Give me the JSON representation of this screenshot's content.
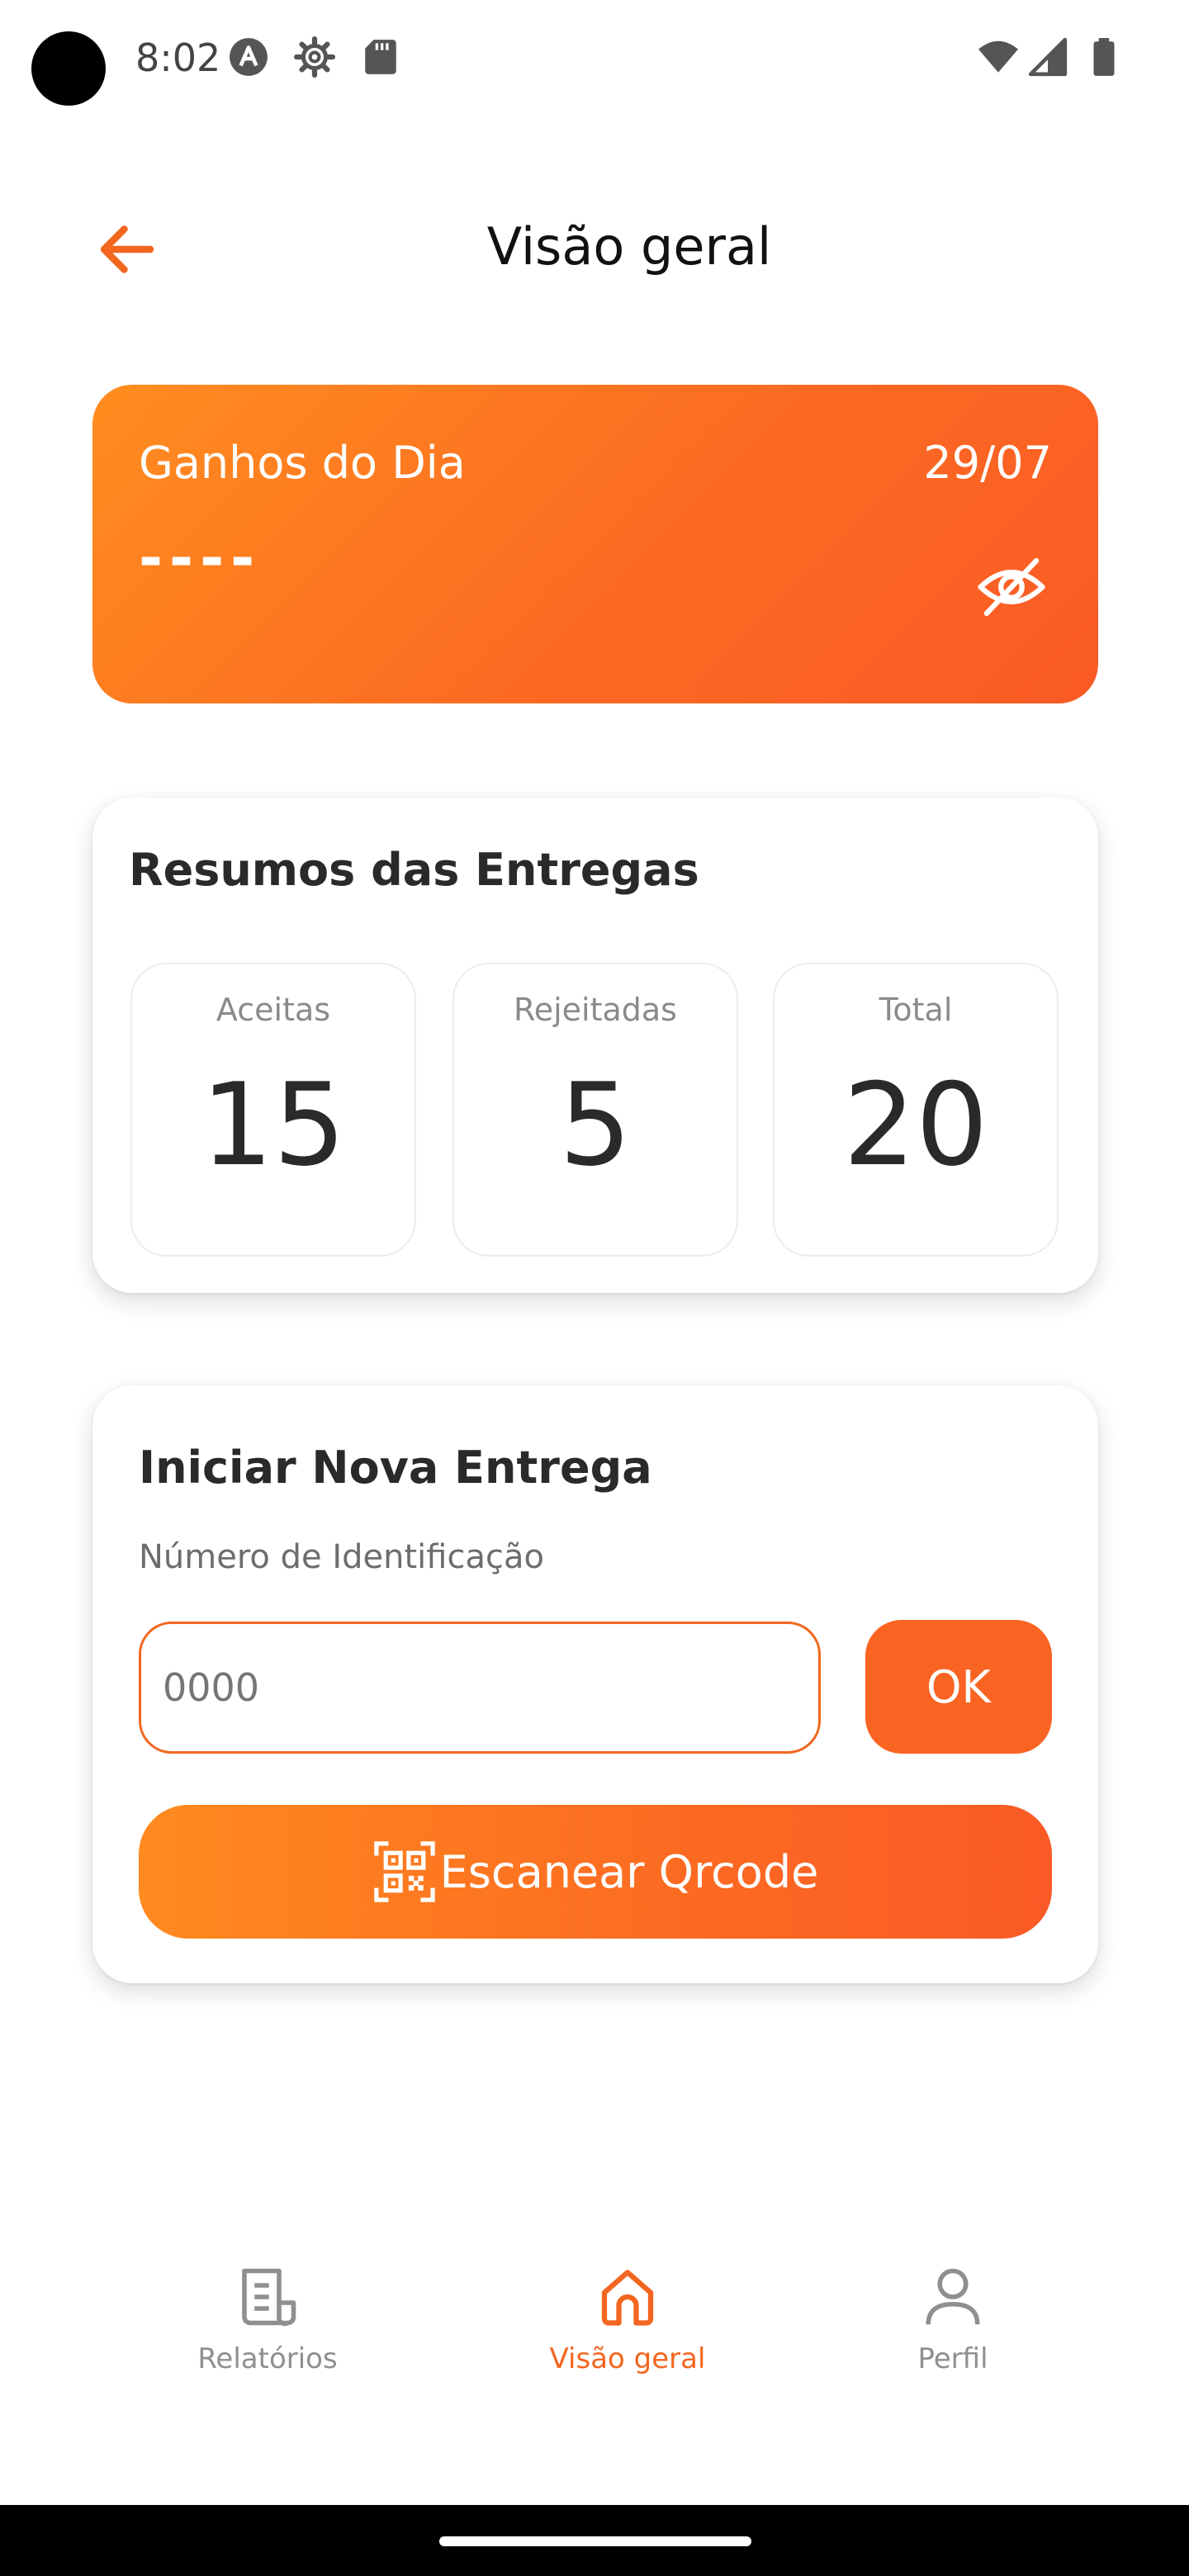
{
  "status_bar": {
    "time": "8:02",
    "icons": [
      "assistant-icon",
      "settings-gear-icon",
      "sd-card-icon",
      "wifi-icon",
      "signal-icon",
      "battery-icon"
    ]
  },
  "header": {
    "title": "Visão geral",
    "back_icon": "arrow-left-icon"
  },
  "earnings": {
    "title": "Ganhos do Dia",
    "date": "29/07",
    "hidden_value": "----",
    "toggle_icon": "eye-off-icon"
  },
  "summary": {
    "title": "Resumos das Entregas",
    "stats": [
      {
        "label": "Aceitas",
        "value": "15"
      },
      {
        "label": "Rejeitadas",
        "value": "5"
      },
      {
        "label": "Total",
        "value": "20"
      }
    ]
  },
  "new_delivery": {
    "title": "Iniciar Nova Entrega",
    "field_label": "Número de Identificação",
    "input_placeholder": "0000",
    "ok_label": "OK",
    "scan_label": "Escanear Qrcode",
    "scan_icon": "qr-code-scan-icon"
  },
  "bottom_nav": {
    "items": [
      {
        "label": "Relatórios",
        "icon": "report-icon",
        "active": false
      },
      {
        "label": "Visão geral",
        "icon": "home-icon",
        "active": true
      },
      {
        "label": "Perfil",
        "icon": "user-icon",
        "active": false
      }
    ]
  },
  "colors": {
    "accent": "#f2661f",
    "gradient_start": "#ff8d1f",
    "gradient_end": "#fa5a25",
    "muted_text": "#8f8f8f"
  }
}
